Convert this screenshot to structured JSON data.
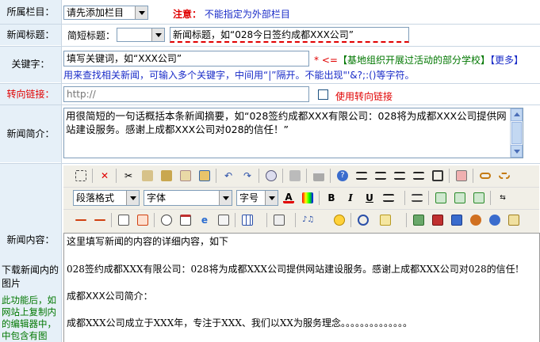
{
  "labels": {
    "column": "所属栏目：",
    "title": "新闻标题：",
    "keywords": "关键字：",
    "redirect": "转向链接：",
    "summary": "新闻简介：",
    "content": "新闻内容：",
    "download_images": "下载新闻内的图片",
    "download_hint": "此功能后，如网站上复制内的编辑器中，中包含有图"
  },
  "column_select": {
    "value": "请先添加栏目"
  },
  "notice": {
    "label": "注意：",
    "text": "不能指定为外部栏目"
  },
  "short_title": {
    "label": "简短标题：",
    "value": ""
  },
  "title_input": {
    "value": "新闻标题，如“028今日签约成都XXX公司”"
  },
  "keywords": {
    "value": "填写关键词，如“XXX公司”",
    "required_mark": "*",
    "arrow": "<=",
    "tags": [
      "【基地组织开展过活动的部分学校】",
      "【更多】"
    ],
    "hint": "用来查找相关新闻，可输入多个关键字，中间用“|”隔开。不能出现\"'&?;:()等字符。"
  },
  "redirect": {
    "placeholder": "http://",
    "checkbox_label": "使用转向链接",
    "checked": false
  },
  "summary": {
    "text": "用很简短的一句话概括本条新闻摘要，如“028签约成都XXX有限公司：028将为成都XXX公司提供网站建设服务。感谢上成都XXX公司对028的信任！”"
  },
  "editor": {
    "format_select": "段落格式",
    "font_select": "字体",
    "size_select": "字号",
    "content_lines": [
      "这里填写新闻的内容的详细内容，如下",
      "",
      "028签约成都XXX有限公司：028将为成都XXX公司提供网站建设服务。感谢上成都XXX公司对028的信任!",
      "",
      "成都XXX公司简介：",
      "",
      "成都XXX公司成立于XXX年，专注于XXX、我们以XX为服务理念。。。。。。。。。。。。。。"
    ]
  },
  "colors": {
    "label_bg": "#e6f0f8",
    "red": "#e00000",
    "blue": "#1a2cc8",
    "green": "#007700",
    "toolbar_bg": "#f1efe7"
  }
}
